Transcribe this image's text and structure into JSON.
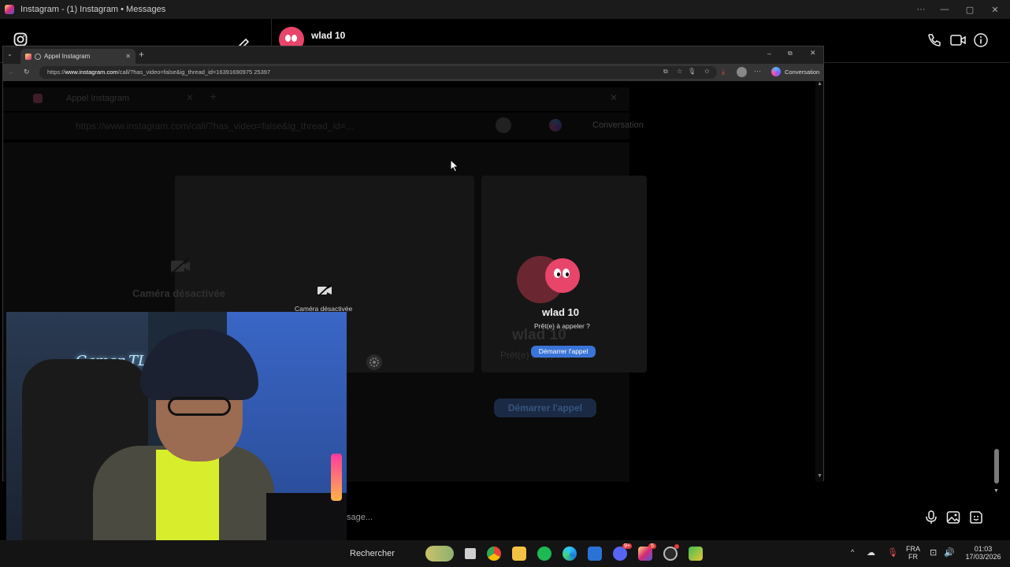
{
  "app_window": {
    "title": "Instagram - (1) Instagram • Messages",
    "contact_name": "wlad 10",
    "composer_placeholder_tail": "sage..."
  },
  "browser": {
    "tab_title": "Appel Instagram",
    "url_prefix": "https://",
    "url_domain": "www.instagram.com",
    "url_path": "/call/?has_video=false&ig_thread_id=16391690975 25397",
    "conversation_label": "Conversation"
  },
  "ghost": {
    "tab_title": "Appel Instagram",
    "url": "https://www.instagram.com/call/?has_video=false&ig_thread_id=...",
    "conversation_label": "Conversation",
    "camera_off_large": "Caméra désactivée",
    "contact_name_large": "wlad 10",
    "ready_large": "Prêt(e) à appeler ?",
    "start_call_large": "Démarrer l'appel"
  },
  "call_card": {
    "camera_off": "Caméra désactivée",
    "contact_name": "wlad 10",
    "ready_prompt": "Prêt(e) à appeler ?",
    "start_call": "Démarrer l'appel"
  },
  "webcam": {
    "neon_sign": "Gamer TL"
  },
  "taskbar": {
    "search_label": "Rechercher",
    "lang_top": "FRA",
    "lang_bottom": "FR",
    "time": "01:03",
    "date": "17/03/2026",
    "spotify_badge": "",
    "discord_badge": "9+",
    "instagram_badge": "5"
  },
  "colors": {
    "accent_blue": "#3a74d8",
    "avatar_pink": "#e8456b"
  }
}
